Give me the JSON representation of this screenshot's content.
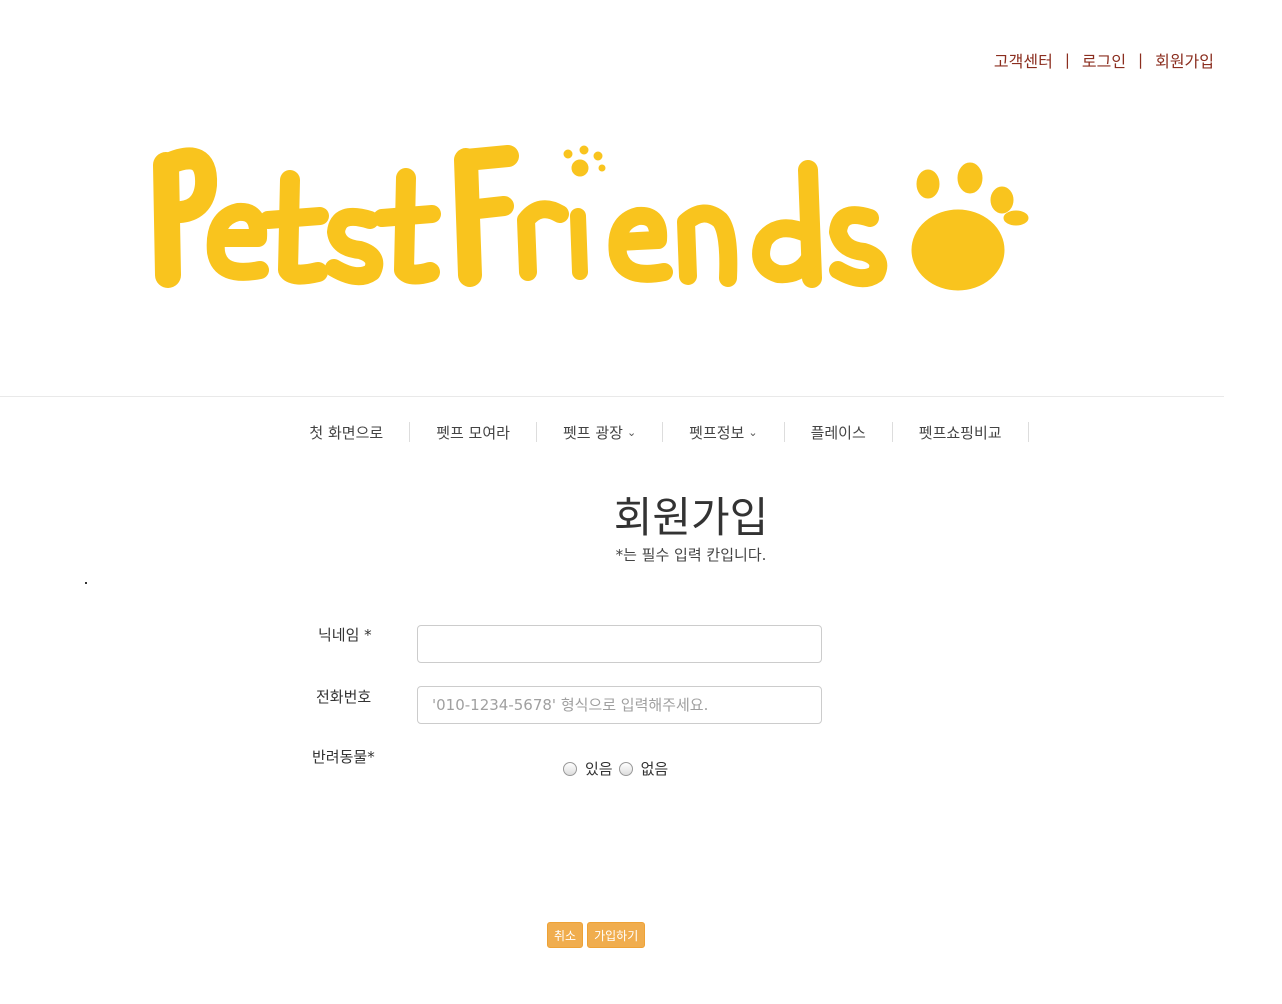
{
  "top_links": {
    "support": "고객센터",
    "login": "로그인",
    "signup": "회원가입",
    "separator": "|"
  },
  "logo": {
    "text": "PetstFriends",
    "color": "#f9c41e"
  },
  "nav": {
    "items": [
      {
        "label": "첫 화면으로",
        "has_dropdown": false
      },
      {
        "label": "펫프 모여라",
        "has_dropdown": false
      },
      {
        "label": "펫프 광장",
        "has_dropdown": true
      },
      {
        "label": "펫프정보",
        "has_dropdown": true
      },
      {
        "label": "플레이스",
        "has_dropdown": false
      },
      {
        "label": "펫프쇼핑비교",
        "has_dropdown": false
      }
    ],
    "chevron": "⌄"
  },
  "page": {
    "title": "회원가입",
    "note": "*는 필수 입력 칸입니다."
  },
  "form": {
    "nickname_label": "닉네임 *",
    "nickname_value": "",
    "phone_label": "전화번호",
    "phone_placeholder": "'010-1234-5678' 형식으로 입력해주세요.",
    "pet_label": "반려동물*",
    "pet_options": [
      "있음",
      "없음"
    ]
  },
  "buttons": {
    "cancel": "취소",
    "submit": "가입하기"
  },
  "colors": {
    "accent": "#f0ad4e",
    "link": "#8b2e1f",
    "logo": "#f9c41e"
  }
}
